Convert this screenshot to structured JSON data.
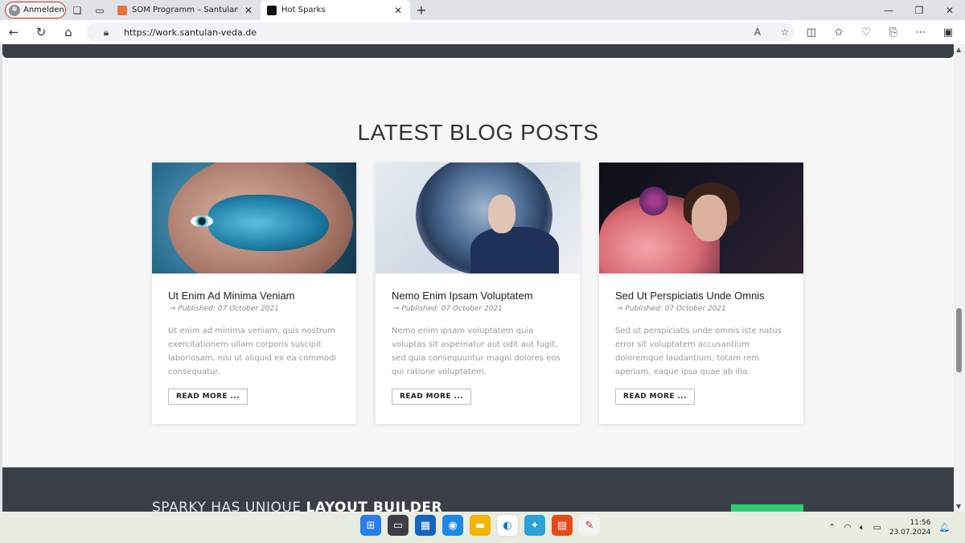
{
  "browser": {
    "profile_label": "Anmelden",
    "tabs": [
      {
        "title": "SOM Programm – Santulan Veda",
        "active": false
      },
      {
        "title": "Hot Sparks",
        "active": true
      }
    ],
    "url": "https://work.santulan-veda.de"
  },
  "page": {
    "section_title": "LATEST BLOG POSTS",
    "posts": [
      {
        "title": "Ut Enim Ad Minima Veniam",
        "meta": "➞ Published: 07 October 2021",
        "excerpt": "Ut enim ad minima veniam, quis nostrum exercitationem ullam corporis suscipit laboriosam, nisi ut aliquid ex ea commodi consequatur.",
        "cta": "READ MORE ..."
      },
      {
        "title": "Nemo Enim Ipsam Voluptatem",
        "meta": "➞ Published: 07 October 2021",
        "excerpt": "Nemo enim ipsam voluptatem quia voluptas sit aspernatur aut odit aut fugit, sed quia consequuntur magni dolores eos qui ratione voluptatem.",
        "cta": "READ MORE ..."
      },
      {
        "title": "Sed Ut Perspiciatis Unde Omnis",
        "meta": "➞ Published: 07 October 2021",
        "excerpt": "Sed ut perspiciatis unde omnis iste natus error sit voluptatem accusantium doloremque laudantium, totam rem aperiam, eaque ipsa quae ab illo.",
        "cta": "READ MORE ..."
      }
    ],
    "footer_banner_prefix": "SPARKY HAS UNIQUE ",
    "footer_banner_bold": "LAYOUT BUILDER"
  },
  "taskbar": {
    "time": "11:56",
    "date": "23.07.2024"
  },
  "colors": {
    "accent_green": "#2ecc71",
    "dark_band": "#3a3f47"
  }
}
